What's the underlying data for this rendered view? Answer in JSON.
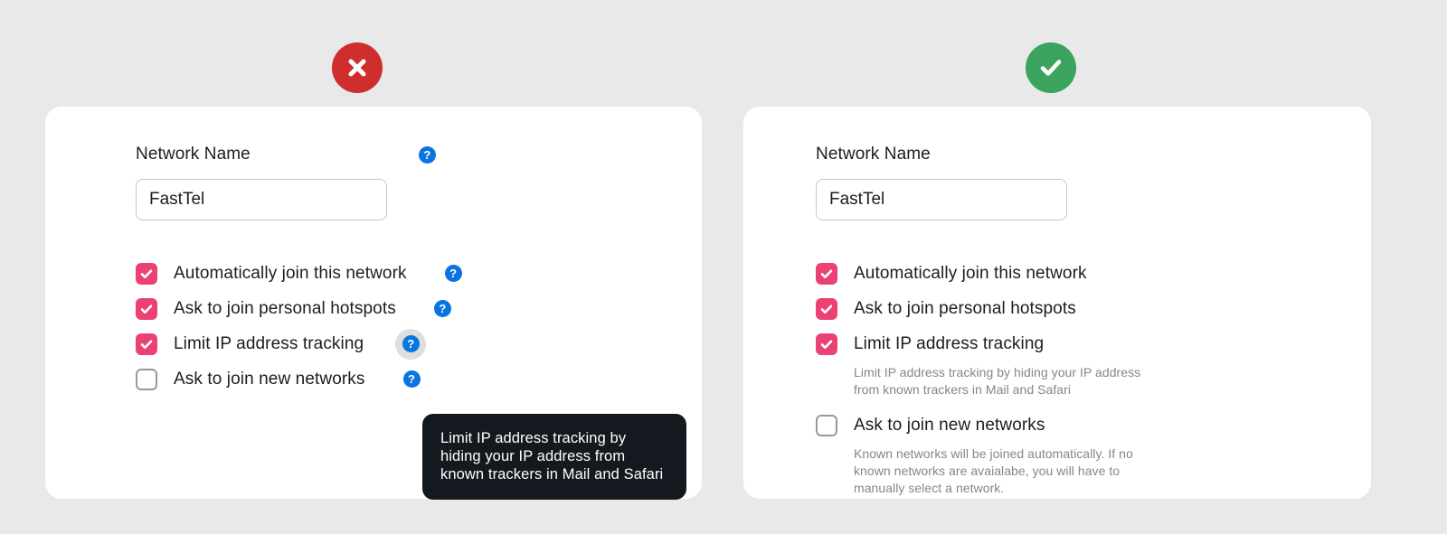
{
  "background_color": "#e9e9e9",
  "badges": {
    "bad": {
      "icon": "cross-circle-icon",
      "color": "#cf2e2e",
      "meaning": "incorrect"
    },
    "good": {
      "icon": "check-circle-icon",
      "color": "#3aa45f",
      "meaning": "correct"
    }
  },
  "colors": {
    "checkbox_checked": "#ec4273",
    "help_icon": "#0a74e0",
    "tooltip_background": "#14181f",
    "card_background": "#ffffff",
    "helper_text": "#86868b"
  },
  "bad_example": {
    "field": {
      "label": "Network Name",
      "value": "FastTel",
      "placeholder": "Network Name",
      "help_icon": "question-mark-icon"
    },
    "options": [
      {
        "label": "Automatically join this network",
        "checked": true,
        "help_icon": "question-mark-icon",
        "help_hovered": false
      },
      {
        "label": "Ask to join personal hotspots",
        "checked": true,
        "help_icon": "question-mark-icon",
        "help_hovered": false
      },
      {
        "label": "Limit IP address tracking",
        "checked": true,
        "help_icon": "question-mark-icon",
        "help_hovered": true
      },
      {
        "label": "Ask to join new networks",
        "checked": false,
        "help_icon": "question-mark-icon",
        "help_hovered": false
      }
    ],
    "tooltip": {
      "text": "Limit IP address tracking by hiding your IP address from known trackers in Mail and Safari",
      "anchor": "Limit IP address tracking"
    }
  },
  "good_example": {
    "field": {
      "label": "Network Name",
      "value": "FastTel",
      "placeholder": "Network Name"
    },
    "options": [
      {
        "label": "Automatically join this network",
        "checked": true,
        "description": ""
      },
      {
        "label": "Ask to join personal hotspots",
        "checked": true,
        "description": ""
      },
      {
        "label": "Limit IP address tracking",
        "checked": true,
        "description": "Limit IP address tracking by hiding your IP address from known trackers in Mail and Safari"
      },
      {
        "label": "Ask to join new networks",
        "checked": false,
        "description": "Known networks will be joined automatically. If no known networks are avaialabe, you will have to manually select a network."
      }
    ]
  }
}
